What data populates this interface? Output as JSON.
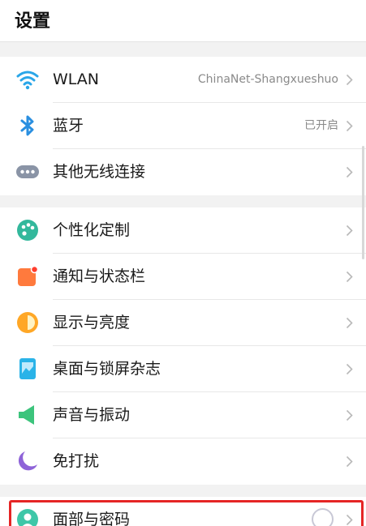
{
  "header": {
    "title": "设置"
  },
  "groups": [
    {
      "items": [
        {
          "label": "WLAN",
          "value": "ChinaNet-Shangxueshuo",
          "icon": "wifi-icon"
        },
        {
          "label": "蓝牙",
          "value": "已开启",
          "icon": "bluetooth-icon"
        },
        {
          "label": "其他无线连接",
          "value": "",
          "icon": "more-connections-icon"
        }
      ]
    },
    {
      "items": [
        {
          "label": "个性化定制",
          "icon": "palette-icon"
        },
        {
          "label": "通知与状态栏",
          "icon": "notification-icon"
        },
        {
          "label": "显示与亮度",
          "icon": "brightness-icon"
        },
        {
          "label": "桌面与锁屏杂志",
          "icon": "wallpaper-icon"
        },
        {
          "label": "声音与振动",
          "icon": "sound-icon"
        },
        {
          "label": "免打扰",
          "icon": "moon-icon"
        }
      ]
    },
    {
      "items": [
        {
          "label": "面部与密码",
          "icon": "face-lock-icon"
        }
      ]
    }
  ],
  "colors": {
    "highlight": "#e52525",
    "wifi": "#2aa6e8",
    "bluetooth": "#2a8fe0",
    "palette": "#33b89c",
    "notification": "#ff7a3d",
    "brightness": "#ffa726",
    "wallpaper": "#2ab3e8",
    "sound": "#3cc47c",
    "moon": "#8e63d8",
    "face": "#3ec7a8"
  }
}
